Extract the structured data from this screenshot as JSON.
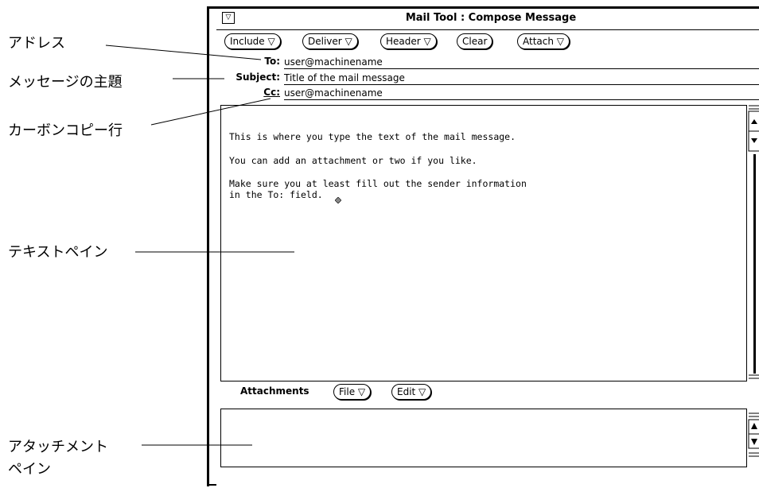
{
  "callouts": {
    "address": "アドレス",
    "subject": "メッセージの主題",
    "cc": "カーボンコピー行",
    "text_pane": "テキストペイン",
    "attach_1": "アタッチメント",
    "attach_2": "ペイン"
  },
  "window": {
    "title": "Mail Tool : Compose Message",
    "menu_glyph": "▽"
  },
  "toolbar": {
    "include": "Include ▽",
    "deliver": "Deliver ▽",
    "header": "Header ▽",
    "clear": "Clear",
    "attach": "Attach ▽"
  },
  "fields": {
    "to_label": "To:",
    "to_value": "user@machinename",
    "subject_label": "Subject:",
    "subject_value": "Title of the mail message",
    "cc_label": "Cc:",
    "cc_value": "user@machinename"
  },
  "message": {
    "line1": "This is where you type the text of the mail message.",
    "line2": "You can add an attachment or two if you like.",
    "line3": "Make sure you at least fill out the sender information",
    "line4": "in the To: field."
  },
  "attachments": {
    "label": "Attachments",
    "file": "File ▽",
    "edit": "Edit ▽"
  }
}
